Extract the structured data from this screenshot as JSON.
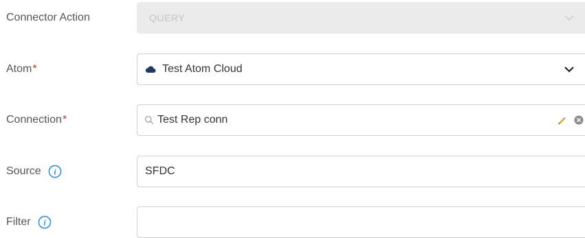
{
  "form": {
    "connector_action": {
      "label": "Connector Action",
      "value": "QUERY"
    },
    "atom": {
      "label": "Atom",
      "required_marker": "*",
      "value": "Test Atom Cloud",
      "icon": "cloud-icon"
    },
    "connection": {
      "label": "Connection",
      "required_marker": "*",
      "value": "Test Rep conn",
      "icons": [
        "search-icon",
        "edit-pencil-icon",
        "clear-icon"
      ]
    },
    "source": {
      "label": "Source",
      "value": "SFDC",
      "icon": "info-icon"
    },
    "filter": {
      "label": "Filter",
      "value": "",
      "icon": "info-icon"
    }
  },
  "colors": {
    "label_text": "#555555",
    "required_marker": "#c0392b",
    "info_icon": "#2f8fd8",
    "disabled_field_bg": "#ebebeb",
    "border": "#cfcfcf",
    "cloud_icon": "#1f3a5f",
    "pencil_icon": "#d4a017"
  }
}
